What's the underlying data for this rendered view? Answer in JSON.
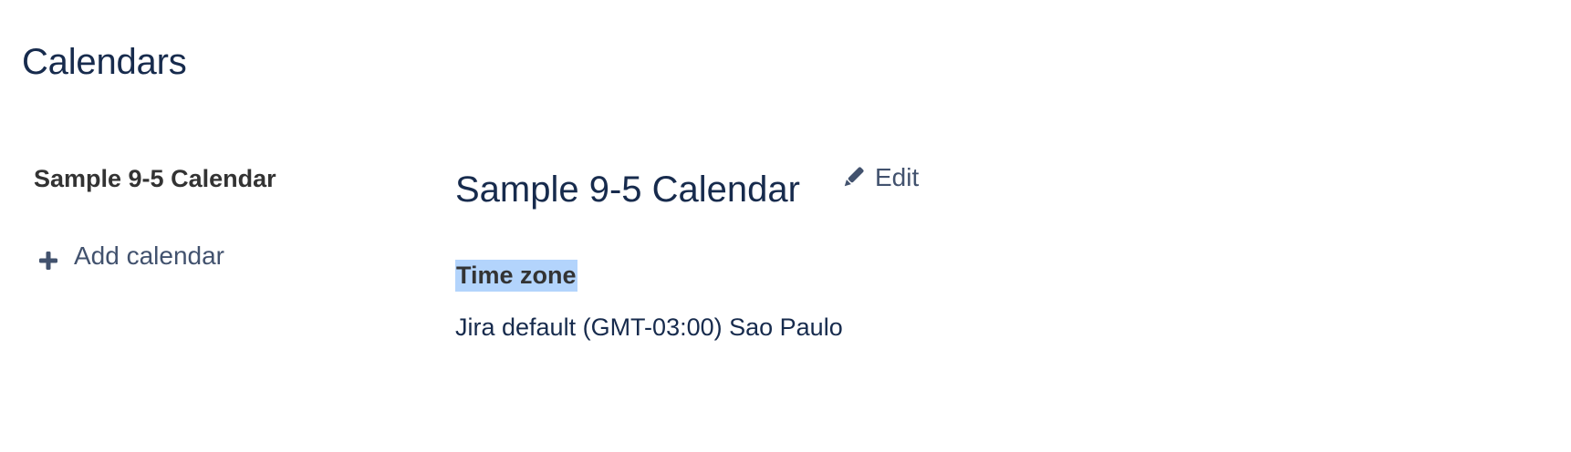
{
  "page": {
    "title": "Calendars"
  },
  "sidebar": {
    "items": [
      {
        "label": "Sample 9-5 Calendar"
      }
    ],
    "add_label": "Add calendar",
    "add_icon": "plus-icon"
  },
  "calendar": {
    "title": "Sample 9-5 Calendar",
    "edit_label": "Edit",
    "edit_icon": "pencil-icon",
    "timezone_label": "Time zone",
    "timezone_value": "Jira default (GMT-03:00) Sao Paulo"
  },
  "colors": {
    "heading": "#172b4d",
    "link": "#42526e",
    "selection": "#b3d4fc"
  }
}
